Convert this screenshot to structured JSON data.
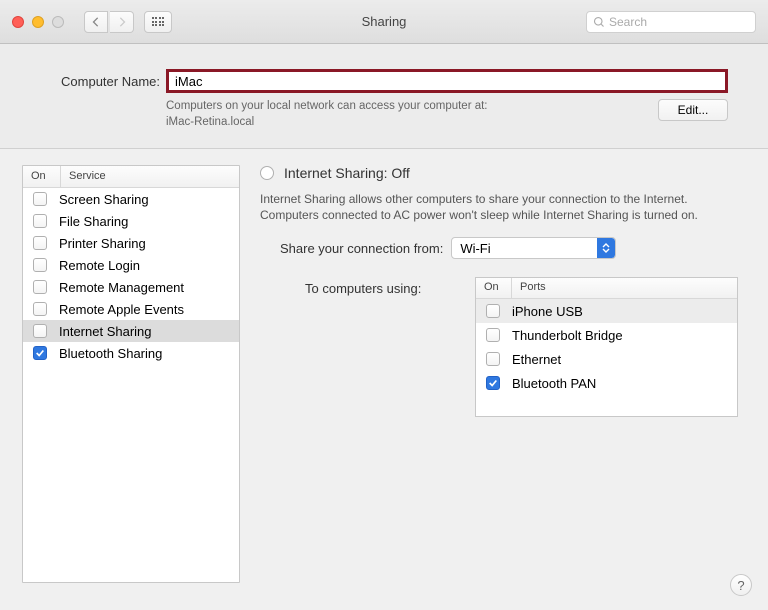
{
  "titlebar": {
    "title": "Sharing",
    "search_placeholder": "Search"
  },
  "top": {
    "name_label": "Computer Name:",
    "name_value": "iMac",
    "desc_line1": "Computers on your local network can access your computer at:",
    "desc_line2": "iMac-Retina.local",
    "edit_label": "Edit..."
  },
  "services": {
    "header_on": "On",
    "header_service": "Service",
    "items": [
      {
        "label": "Screen Sharing",
        "checked": false,
        "selected": false
      },
      {
        "label": "File Sharing",
        "checked": false,
        "selected": false
      },
      {
        "label": "Printer Sharing",
        "checked": false,
        "selected": false
      },
      {
        "label": "Remote Login",
        "checked": false,
        "selected": false
      },
      {
        "label": "Remote Management",
        "checked": false,
        "selected": false
      },
      {
        "label": "Remote Apple Events",
        "checked": false,
        "selected": false
      },
      {
        "label": "Internet Sharing",
        "checked": false,
        "selected": true
      },
      {
        "label": "Bluetooth Sharing",
        "checked": true,
        "selected": false
      }
    ]
  },
  "detail": {
    "title": "Internet Sharing: Off",
    "desc": "Internet Sharing allows other computers to share your connection to the Internet. Computers connected to AC power won't sleep while Internet Sharing is turned on.",
    "share_from_label": "Share your connection from:",
    "share_from_value": "Wi-Fi",
    "computers_label": "To computers using:",
    "ports_header_on": "On",
    "ports_header_ports": "Ports",
    "ports": [
      {
        "label": "iPhone USB",
        "checked": false
      },
      {
        "label": "Thunderbolt Bridge",
        "checked": false
      },
      {
        "label": "Ethernet",
        "checked": false
      },
      {
        "label": "Bluetooth PAN",
        "checked": true
      }
    ]
  },
  "help_label": "?"
}
